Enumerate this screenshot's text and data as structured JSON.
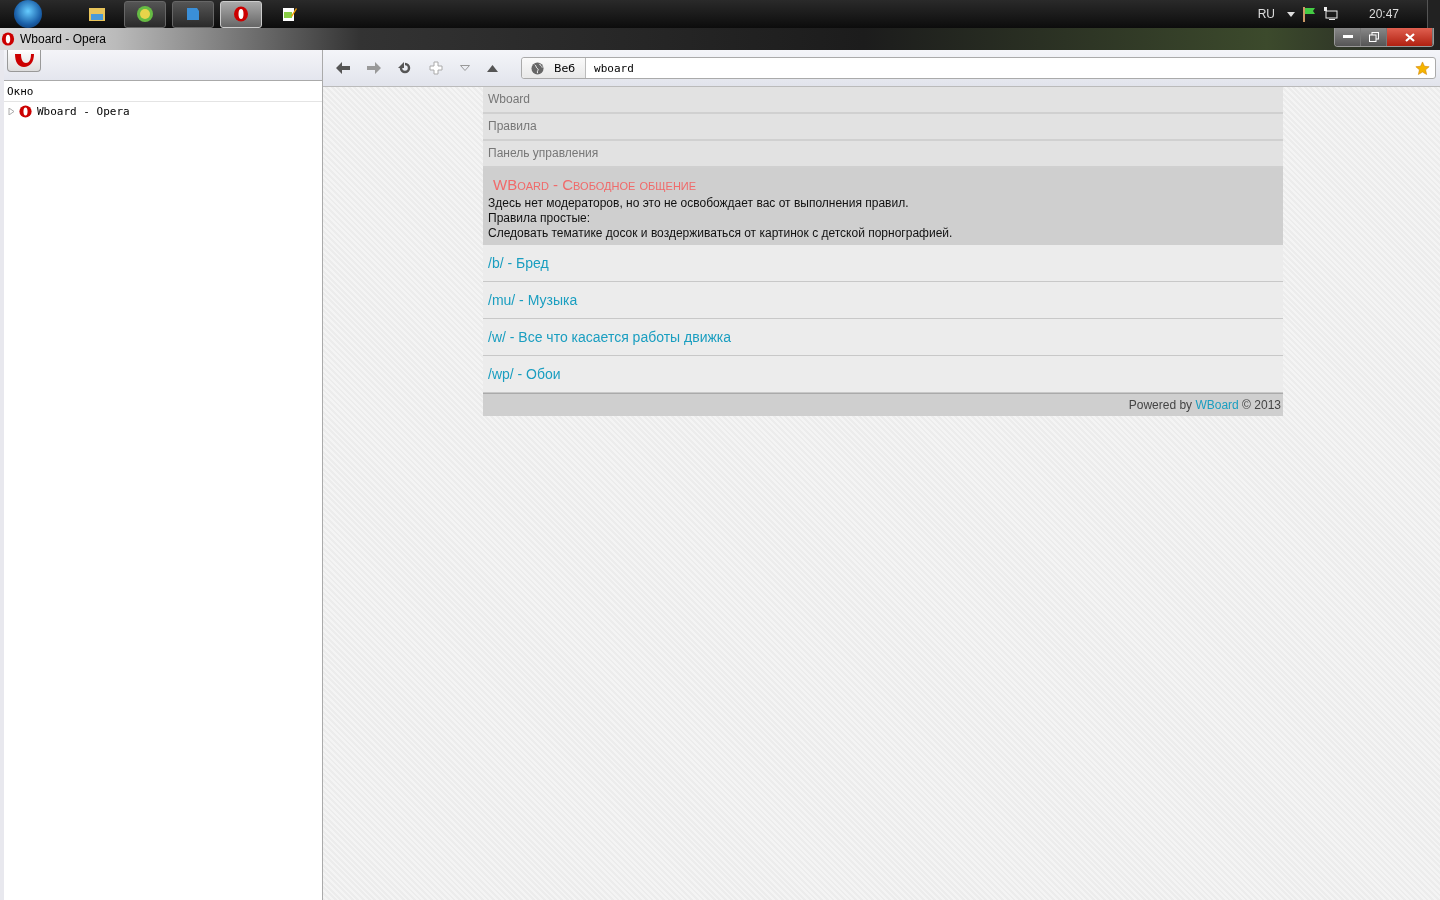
{
  "taskbar": {
    "buttons": [
      {
        "kind": "folder",
        "selected": false
      },
      {
        "kind": "hs",
        "selected": false
      },
      {
        "kind": "doc",
        "selected": false
      },
      {
        "kind": "opera",
        "selected": true
      },
      {
        "kind": "notepad",
        "selected": false
      }
    ],
    "tray": {
      "language": "RU",
      "clock": "20:47"
    }
  },
  "window": {
    "title": "Wboard - Opera"
  },
  "sidebar": {
    "header": "Окно",
    "items": [
      {
        "label": "Wboard - Opera",
        "expanded": false
      }
    ]
  },
  "address": {
    "mode": "Веб",
    "value": "wboard"
  },
  "nav": [
    "Wboard",
    "Правила",
    "Панель управления"
  ],
  "intro": {
    "title": "WBoard - Свободное общение",
    "lines": [
      "Здесь нет модераторов, но это не освобождает вас от выполнения правил.",
      "Правила простые:",
      "Следовать тематике досок и воздерживаться от картинок с детской порнографией."
    ]
  },
  "boards": [
    "/b/ - Бред",
    "/mu/ - Музыка",
    "/w/ - Все что касается работы движка",
    "/wp/ - Обои"
  ],
  "footer": {
    "prefix": "Powered by",
    "link": "WBoard",
    "suffix": "© 2013"
  }
}
